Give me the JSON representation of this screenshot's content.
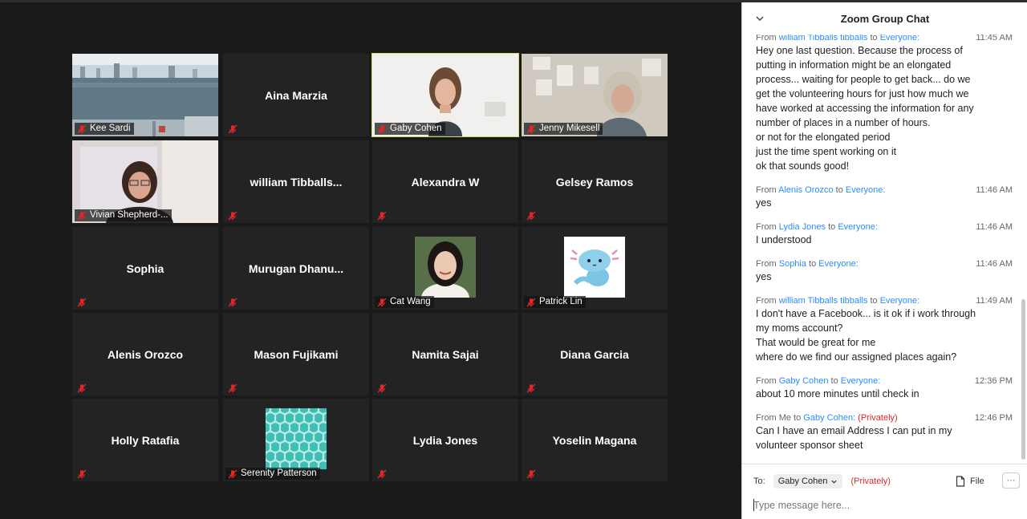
{
  "participants": [
    {
      "name": "Kee Sardi",
      "label": "Kee Sardi",
      "type": "video"
    },
    {
      "name": "Aina Marzia",
      "type": "name"
    },
    {
      "name": "Gaby Cohen",
      "label": "Gaby Cohen",
      "type": "video",
      "active": true
    },
    {
      "name": "Jenny Mikesell",
      "label": "Jenny Mikesell",
      "type": "video"
    },
    {
      "name": "Vivian Shepherd-...",
      "label": "Vivian Shepherd-...",
      "type": "video"
    },
    {
      "name": "william  Tibballs...",
      "type": "name"
    },
    {
      "name": "Alexandra W",
      "type": "name"
    },
    {
      "name": "Gelsey Ramos",
      "type": "name"
    },
    {
      "name": "Sophia",
      "type": "name"
    },
    {
      "name": "Murugan  Dhanu...",
      "type": "name"
    },
    {
      "name": "Cat Wang",
      "label": "Cat Wang",
      "type": "picture"
    },
    {
      "name": "Patrick Lin",
      "label": "Patrick Lin",
      "type": "picture"
    },
    {
      "name": "Alenis Orozco",
      "type": "name"
    },
    {
      "name": "Mason Fujikami",
      "type": "name"
    },
    {
      "name": "Namita Sajai",
      "type": "name"
    },
    {
      "name": "Diana Garcia",
      "type": "name"
    },
    {
      "name": "Holly Ratafia",
      "type": "name"
    },
    {
      "name": "Serenity Patterson",
      "label": "Serenity Patterson",
      "type": "picture"
    },
    {
      "name": "Lydia Jones",
      "type": "name"
    },
    {
      "name": "Yoselin Magana",
      "type": "name"
    }
  ],
  "chat": {
    "title": "Zoom Group Chat",
    "messages": [
      {
        "from_prefix": "From",
        "sender": "william Tibballs tibballs",
        "to_word": "to",
        "recipient": "Everyone:",
        "private": "",
        "time": "11:45 AM",
        "lines": [
          "Hey one last question. Because the process of",
          "putting in information might be an elongated",
          "process... waiting for people to get back... do we",
          "get the volunteering hours for just how much we",
          "have worked at accessing the information for any",
          "number of places in a number of hours.",
          "or not for the elongated period",
          "just the time spent working on it",
          "ok that sounds good!"
        ]
      },
      {
        "from_prefix": "From",
        "sender": "Alenis Orozco",
        "to_word": "to",
        "recipient": "Everyone:",
        "private": "",
        "time": "11:46 AM",
        "lines": [
          "yes"
        ]
      },
      {
        "from_prefix": "From",
        "sender": "Lydia Jones",
        "to_word": "to",
        "recipient": "Everyone:",
        "private": "",
        "time": "11:46 AM",
        "lines": [
          "I understood"
        ]
      },
      {
        "from_prefix": "From",
        "sender": "Sophia",
        "to_word": " to",
        "recipient": "Everyone:",
        "private": "",
        "time": "11:46 AM",
        "lines": [
          "yes"
        ]
      },
      {
        "from_prefix": "From",
        "sender": "william Tibballs tibballs",
        "to_word": "to",
        "recipient": "Everyone:",
        "private": "",
        "time": "11:49 AM",
        "lines": [
          "I don't have a Facebook... is it ok if i work through",
          "my moms account?",
          "That would be great for me",
          "where do we find our assigned places again?"
        ]
      },
      {
        "from_prefix": "From",
        "sender": "Gaby Cohen",
        "to_word": "to",
        "recipient": "Everyone:",
        "private": "",
        "time": "12:36 PM",
        "lines": [
          "about 10 more minutes until check in"
        ]
      },
      {
        "from_prefix": "From Me to",
        "sender": "",
        "to_word": "",
        "recipient": "Gaby Cohen:",
        "private": "(Privately)",
        "time": "12:46 PM",
        "lines": [
          "Can I have an email Address I can put in my",
          "volunteer sponsor sheet"
        ]
      }
    ],
    "footer": {
      "to_label": "To:",
      "recipient": "Gaby Cohen",
      "privacy": "(Privately)",
      "file_label": "File",
      "more_label": "···",
      "placeholder": "Type message here..."
    }
  }
}
